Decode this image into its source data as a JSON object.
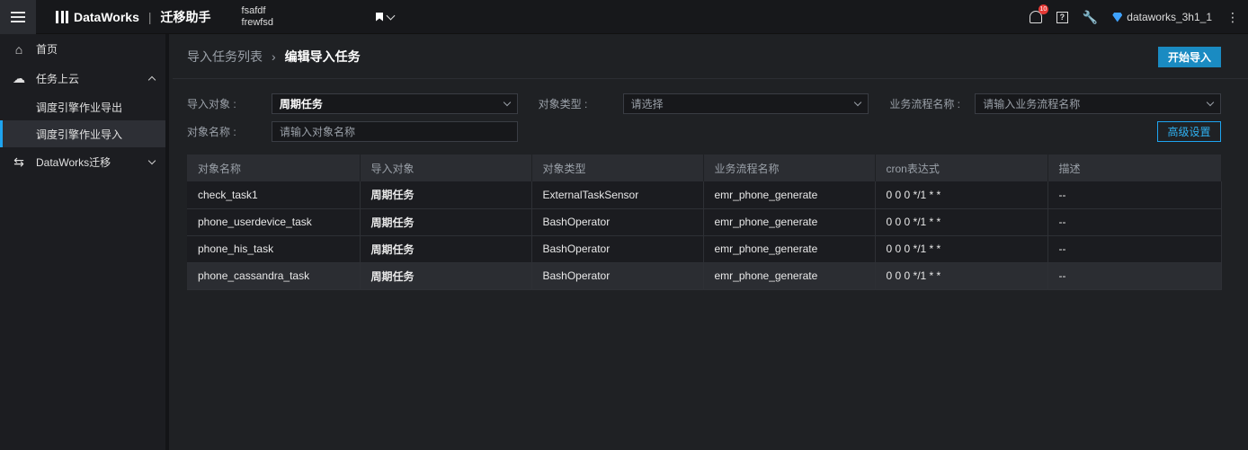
{
  "topbar": {
    "brand": "DataWorks",
    "sep": "|",
    "app_title": "迁移助手",
    "workspace_line1": "fsafdf",
    "workspace_line2": "frewfsd",
    "notification_count": "10",
    "help_icon_text": "?",
    "user_name": "dataworks_3h1_1",
    "kebab": "⋮",
    "wrench": "🔧"
  },
  "sidebar": {
    "home": "首页",
    "task_cloud": "任务上云",
    "sub_export": "调度引擎作业导出",
    "sub_import": "调度引擎作业导入",
    "migration": "DataWorks迁移"
  },
  "header": {
    "crumb_parent": "导入任务列表",
    "crumb_sep": "›",
    "crumb_current": "编辑导入任务",
    "start_import": "开始导入"
  },
  "filters": {
    "import_object_label": "导入对象 :",
    "import_object_value": "周期任务",
    "object_type_label": "对象类型 :",
    "object_type_placeholder": "请选择",
    "flow_name_label": "业务流程名称 :",
    "flow_name_placeholder": "请输入业务流程名称",
    "object_name_label": "对象名称 :",
    "object_name_placeholder": "请输入对象名称",
    "advanced": "高级设置"
  },
  "table": {
    "headers": [
      "对象名称",
      "导入对象",
      "对象类型",
      "业务流程名称",
      "cron表达式",
      "描述"
    ],
    "rows": [
      [
        "check_task1",
        "周期任务",
        "ExternalTaskSensor",
        "emr_phone_generate",
        "0 0 0 */1 * *",
        "--"
      ],
      [
        "phone_userdevice_task",
        "周期任务",
        "BashOperator",
        "emr_phone_generate",
        "0 0 0 */1 * *",
        "--"
      ],
      [
        "phone_his_task",
        "周期任务",
        "BashOperator",
        "emr_phone_generate",
        "0 0 0 */1 * *",
        "--"
      ],
      [
        "phone_cassandra_task",
        "周期任务",
        "BashOperator",
        "emr_phone_generate",
        "0 0 0 */1 * *",
        "--"
      ]
    ]
  },
  "colors": {
    "accent": "#1ea4f0",
    "primary_button": "#1a8bc2",
    "badge": "#e53935"
  }
}
